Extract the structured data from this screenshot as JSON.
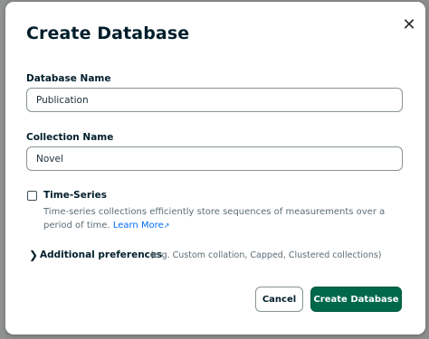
{
  "dialog": {
    "title": "Create Database",
    "close_icon": "close-icon"
  },
  "database_name": {
    "label": "Database Name",
    "value": "Publication"
  },
  "collection_name": {
    "label": "Collection Name",
    "value": "Novel"
  },
  "time_series": {
    "label": "Time-Series",
    "checked": false,
    "description": "Time-series collections efficiently store sequences of measurements over a period of time.",
    "learn_more": "Learn More"
  },
  "additional_preferences": {
    "label": "Additional preferences",
    "note": "(e.g. Custom collation, Capped, Clustered collections)",
    "expanded": false
  },
  "buttons": {
    "cancel": "Cancel",
    "create": "Create Database"
  },
  "colors": {
    "primary_button": "#00684a",
    "link": "#016bf8",
    "overlay": "#8a8d8c"
  }
}
